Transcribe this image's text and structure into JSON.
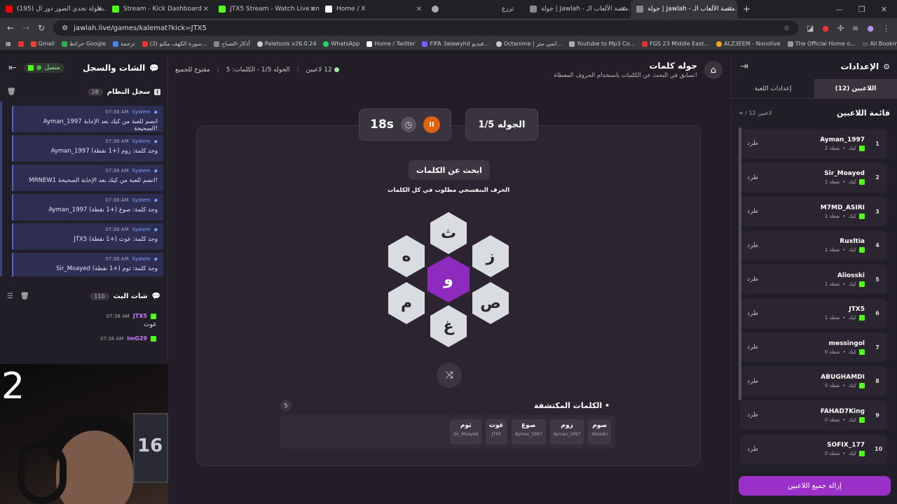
{
  "browser": {
    "tabs": [
      {
        "label": "(195) بطولة تحدي الصور دور ال...",
        "color": "#ff0000"
      },
      {
        "label": "Stream - Kick Dashboard",
        "color": "#53fc18"
      },
      {
        "label": "JTX5 Stream - Watch Live on Ki...",
        "color": "#53fc18"
      },
      {
        "label": "Home / X",
        "color": "#ffffff"
      },
      {
        "label": "",
        "color": "#aaaaaa"
      },
      {
        "label": "ترزع",
        "color": "#888888"
      },
      {
        "label": "جولة | Jawlah - منصة الألعاب الـ...",
        "color": "#cccccc"
      },
      {
        "label": "جولة | Jawlah - منصة الألعاب الـ...",
        "color": "#cccccc"
      }
    ],
    "url": "jawlah.live/games/kalemat?kick=JTX5",
    "bookmarks": [
      "Gmail",
      "خرائط Google",
      "ترجمة",
      "(3) سورة الكهف مكتو...",
      "أذكار-الصباح",
      "Paletools v26.0.24",
      "WhatsApp",
      "Home / Twitter",
      "FIFA 3alawyhd فيديو...",
      "Octanime | انمي متر...",
      "Youtube to Mp3 Co...",
      "FGS 23 Middle East...",
      "ALZ3EEM - Nonolive",
      "The Official Home o..."
    ],
    "all_bookmarks": "All Bookmarks"
  },
  "chat": {
    "title": "الشات والسجل",
    "status": "متصل",
    "system_log_label": "سجل النظام",
    "system_log_count": "28",
    "system_messages": [
      {
        "sender": "System",
        "time": "07:38 AM",
        "text": "Ayman_1997 انضم للعبة من كيك بعد الإجابة الصحيحة!"
      },
      {
        "sender": "System",
        "time": "07:38 AM",
        "text": "Ayman_1997 وجد كلمة: زوم (+1 نقطة)"
      },
      {
        "sender": "System",
        "time": "07:38 AM",
        "text": "MRNEW1 انضم للعبة من كيك بعد الإجابة الصحيحة!"
      },
      {
        "sender": "System",
        "time": "07:38 AM",
        "text": "Ayman_1997 وجد كلمة: صوغ (+1 نقطة)"
      },
      {
        "sender": "System",
        "time": "07:38 AM",
        "text": "JTX5 وجد كلمة: غوث (+1 نقطة)"
      },
      {
        "sender": "System",
        "time": "07:38 AM",
        "text": "Sir_Moayed وجد كلمة: ثوم (+1 نقطة)"
      }
    ],
    "stream_chat_label": "شات البث",
    "stream_chat_count": "110",
    "stream_messages": [
      {
        "user": "JTX5",
        "time": "07:38 AM",
        "text": "غوث"
      },
      {
        "user": "imG29",
        "time": "07:38 AM",
        "text": ""
      }
    ],
    "webcam_number": "2",
    "webcam_poster": "16"
  },
  "game": {
    "title": "جوله كلمات",
    "subtitle": "تسابق في البحث عن الكلمات باستخدام الحروف المعطاة!",
    "players_online": "12 لاعبين",
    "round_info": "الجوله 1/5 - الكلمات: 5",
    "mode": "مفتوح للجميع",
    "round": "الجوله 1/5",
    "timer": "18s",
    "find_label": "ابحث عن الكلمات",
    "hint": "الحرف البنفسجي مطلوب في كل الكلمات",
    "letters": {
      "center": "و",
      "top": "ث",
      "top_right": "ز",
      "bottom_right": "ص",
      "bottom": "غ",
      "bottom_left": "م",
      "top_left": "ه"
    },
    "found_title": "الكلمات المكتشفة",
    "found_count": "5",
    "found_words": [
      {
        "word": "صوم",
        "by": "Aliosski"
      },
      {
        "word": "زوم",
        "by": "Ayman_1997"
      },
      {
        "word": "صوغ",
        "by": "Ayman_1997"
      },
      {
        "word": "غوث",
        "by": "JTX5"
      },
      {
        "word": "ثوم",
        "by": "Sir_Moayed"
      }
    ]
  },
  "settings": {
    "title": "الإعدادات",
    "tab_players": "اللاعبين (12)",
    "tab_game": "إعدادات اللعبة",
    "list_title": "قائمة اللاعبين",
    "list_sub": "∞ / 12 لاعبين",
    "kick_label": "طرد",
    "platform": "كيك",
    "players": [
      {
        "rank": "1",
        "name": "Ayman_1997",
        "points": "2 نقطة"
      },
      {
        "rank": "2",
        "name": "Sir_Moayed",
        "points": "1 نقطة"
      },
      {
        "rank": "3",
        "name": "M7MD_ASIRI",
        "points": "1 نقطة"
      },
      {
        "rank": "4",
        "name": "Ruxltia",
        "points": "1 نقطة"
      },
      {
        "rank": "5",
        "name": "Aliosski",
        "points": "1 نقطة"
      },
      {
        "rank": "6",
        "name": "JTX5",
        "points": "1 نقطة"
      },
      {
        "rank": "7",
        "name": "messingol",
        "points": "0 نقطة"
      },
      {
        "rank": "8",
        "name": "ABUGHAMDI",
        "points": "0 نقطة"
      },
      {
        "rank": "9",
        "name": "FAHAD7King",
        "points": "0 نقطة"
      },
      {
        "rank": "10",
        "name": "SOFIX_177",
        "points": "0 نقطة"
      }
    ],
    "remove_all": "إزالة جميع اللاعبين"
  }
}
